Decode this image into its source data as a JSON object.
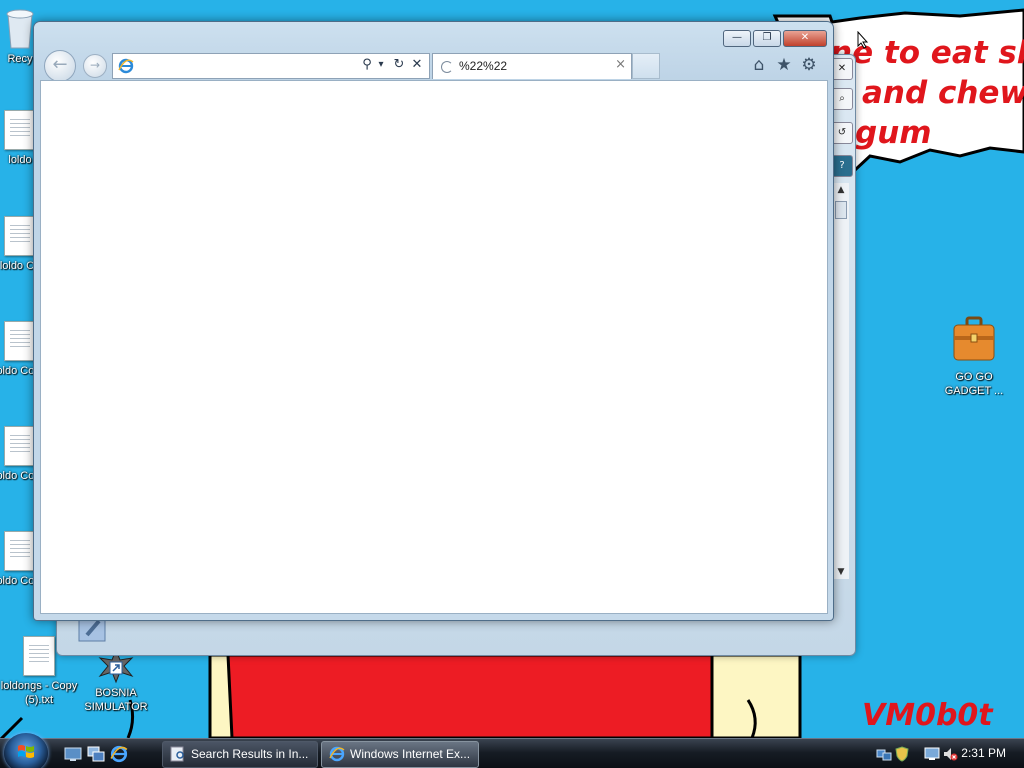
{
  "wallpaper": {
    "speech_lines": [
      "ne to eat shit",
      "and chew",
      "gum"
    ],
    "signature": "VM0b0t",
    "colors": {
      "sky": "#27b2e8",
      "red": "#e0161c",
      "cream": "#fdf6c3"
    }
  },
  "desktop_icons": [
    {
      "label": "Recy",
      "icon": "recycle-bin-icon"
    },
    {
      "label": "loldo",
      "icon": "text-file-icon"
    },
    {
      "label": "loldo Co",
      "icon": "text-file-icon"
    },
    {
      "label": "loldo Copy",
      "icon": "text-file-icon"
    },
    {
      "label": "loldo Copy",
      "icon": "text-file-icon"
    },
    {
      "label": "loldo Copy",
      "icon": "text-file-icon"
    },
    {
      "label": "loldongs - Copy (5).txt",
      "icon": "text-file-icon"
    },
    {
      "label": "BOSNIA SIMULATOR",
      "icon": "shortcut-icon"
    },
    {
      "label": "GO GO GADGET ...",
      "icon": "briefcase-icon"
    }
  ],
  "browser": {
    "address_value": "",
    "tab_title": "%22%22",
    "tab_close": "×",
    "caption": {
      "minimize": "—",
      "restore": "❐",
      "close": "✕"
    },
    "nav": {
      "back": "←",
      "forward": "→"
    },
    "address_buttons": {
      "search": "⚲",
      "dropdown": "▾",
      "refresh": "↻",
      "stop": "✕"
    },
    "tools": {
      "home": "⌂",
      "favorites": "★",
      "settings": "⚙"
    }
  },
  "back_window": {
    "scroll_up": "▲",
    "scroll_down": "▼",
    "side_buttons": [
      "✕",
      "⌕",
      "↺",
      "?"
    ]
  },
  "taskbar": {
    "quick_launch": [
      "show-desktop-icon",
      "switch-windows-icon",
      "ie-quicklaunch-icon"
    ],
    "buttons": [
      {
        "label": "Search Results in In...",
        "active": false
      },
      {
        "label": "Windows Internet Ex...",
        "active": true
      }
    ],
    "clock": "2:31 PM"
  }
}
